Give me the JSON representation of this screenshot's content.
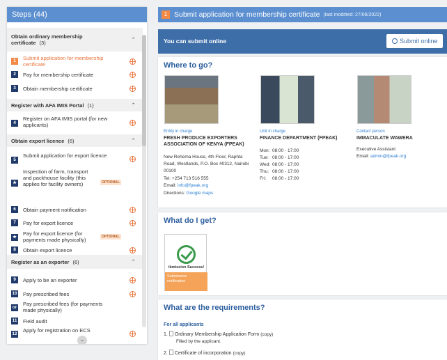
{
  "sidebar": {
    "title": "Steps (44)",
    "groups": [
      {
        "title": "Obtain ordinary membership certificate",
        "count": "(3)"
      },
      {
        "title": "Register with AFA IMIS Portal",
        "count": "(1)"
      },
      {
        "title": "Obtain export licence",
        "count": "(6)"
      },
      {
        "title": "Register as an exporter",
        "count": "(6)"
      }
    ],
    "steps": [
      {
        "num": "1",
        "label": "Submit application for membership certificate"
      },
      {
        "num": "2",
        "label": "Pay for membership certificate"
      },
      {
        "num": "3",
        "label": "Obtain membership certificate"
      },
      {
        "num": "4",
        "label": "Register on AFA IMIS portal (for new applicants)"
      },
      {
        "num": "5",
        "label": "Submit application for export licence"
      },
      {
        "num": "★",
        "label": "Inspection of farm, transport and packhouse facility (this applies for facility owners)"
      },
      {
        "num": "6",
        "label": "Obtain payment notification"
      },
      {
        "num": "7",
        "label": "Pay for export licence"
      },
      {
        "num": "★",
        "label": "Pay for export licence (for payments made physically)"
      },
      {
        "num": "8",
        "label": "Obtain export licence"
      },
      {
        "num": "9",
        "label": "Apply to be an exporter"
      },
      {
        "num": "10",
        "label": "Pay prescribed fees"
      },
      {
        "num": "or",
        "label": "Pay prescribed fees (for payments made physically)"
      },
      {
        "num": "11",
        "label": "Field audit"
      },
      {
        "num": "12",
        "label": "Apply for registration on ECS"
      }
    ],
    "optional_label": "OPTIONAL"
  },
  "header": {
    "num": "1",
    "title": "Submit application for membership certificate",
    "last_modified": "(last modified: 27/06/2022)"
  },
  "online": {
    "text": "You can submit online",
    "button": "Submit online"
  },
  "where": {
    "heading": "Where to go?",
    "entity_label": "Entity in charge",
    "entity_name": "FRESH PRODUCE EXPORTERS ASSOCIATION OF KENYA (FPEAK)",
    "address": "New Rehema House, 4th Floor, Raphta Road, Westlands, P.O. Box 40312, Nairobi 00100",
    "tel": "Tel: +254 713 516 555",
    "email_label": "Email: ",
    "email": "info@fpeak.org",
    "directions_label": "Directions: ",
    "directions": "Google maps",
    "unit_label": "Unit in charge",
    "unit_name": "FINANCE DEPARTMENT (FPEAK)",
    "hours": [
      {
        "day": "Mon:",
        "time": "08:00 - 17:00"
      },
      {
        "day": "Tue:",
        "time": "08:00 - 17:00"
      },
      {
        "day": "Wed:",
        "time": "08:00 - 17:00"
      },
      {
        "day": "Thu:",
        "time": "08:00 - 17:00"
      },
      {
        "day": "Fri:",
        "time": "08:00 - 17:00"
      }
    ],
    "contact_label": "Contact person",
    "contact_name": "IMMACULATE WAWERA",
    "contact_role": "Executive Assistant",
    "contact_email_label": "Email: ",
    "contact_email": "admin@fpeak.org"
  },
  "get": {
    "heading": "What do I get?",
    "cert_text": "ibmission Success!",
    "cert_footer": "Submission notification"
  },
  "requirements": {
    "heading": "What are the requirements?",
    "sub": "For all applicants",
    "items": [
      {
        "num": "1.",
        "name": "Ordinary Membership Application Form",
        "copy": "(copy)",
        "note": "Filled by the applicant."
      },
      {
        "num": "2.",
        "name": "Certificate of incorporation",
        "copy": "(copy)"
      }
    ]
  }
}
